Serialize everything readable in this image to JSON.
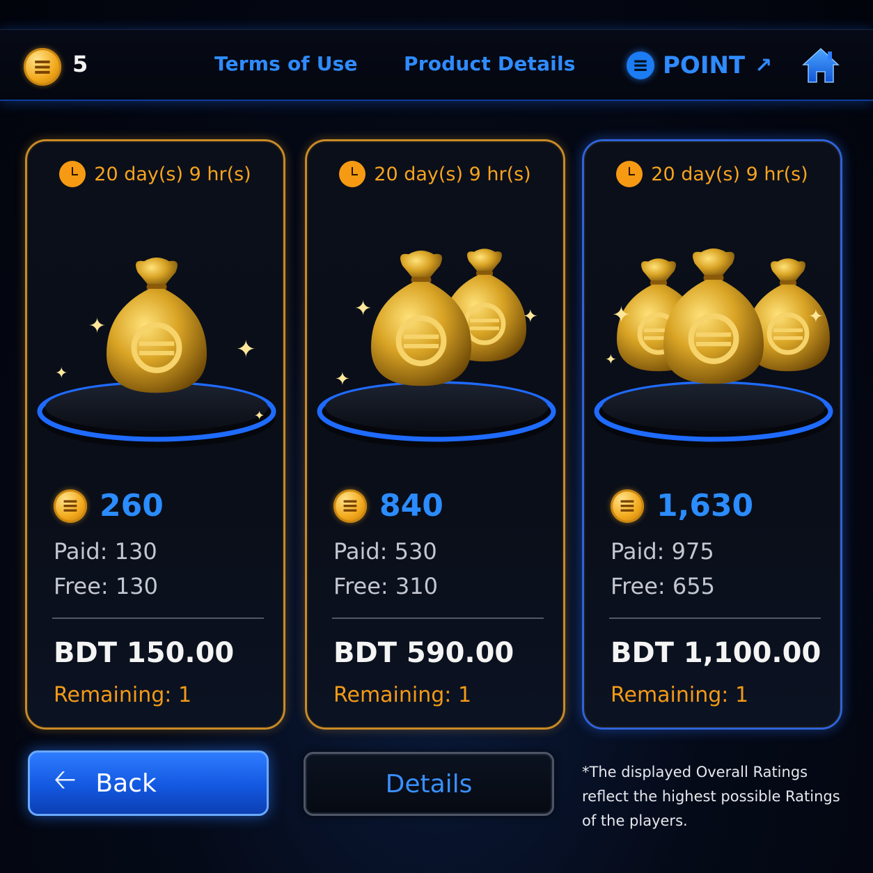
{
  "header": {
    "coin_count": "5",
    "links": {
      "terms": "Terms of Use",
      "product_details": "Product Details",
      "point": "POINT"
    }
  },
  "offers": [
    {
      "timer": "20 day(s) 9 hr(s)",
      "amount": "260",
      "paid": "Paid: 130",
      "free": "Free: 130",
      "price": "BDT 150.00",
      "remaining": "Remaining: 1",
      "bag_count": 1
    },
    {
      "timer": "20 day(s) 9 hr(s)",
      "amount": "840",
      "paid": "Paid: 530",
      "free": "Free: 310",
      "price": "BDT 590.00",
      "remaining": "Remaining: 1",
      "bag_count": 2
    },
    {
      "timer": "20 day(s) 9 hr(s)",
      "amount": "1,630",
      "paid": "Paid: 975",
      "free": "Free: 655",
      "price": "BDT 1,100.00",
      "remaining": "Remaining: 1",
      "bag_count": 3
    }
  ],
  "buttons": {
    "back": "Back",
    "details": "Details"
  },
  "footnote": "*The displayed Overall Ratings reflect the highest possible Ratings of the players.",
  "colors": {
    "accent_blue": "#2f8bff",
    "gold": "#f2a91c",
    "orange_text": "#f39a17"
  },
  "icons": [
    "coin-icon",
    "point-icon",
    "arrow-up-right-icon",
    "home-icon",
    "clock-icon",
    "money-bag-icon",
    "arrow-left-icon"
  ]
}
